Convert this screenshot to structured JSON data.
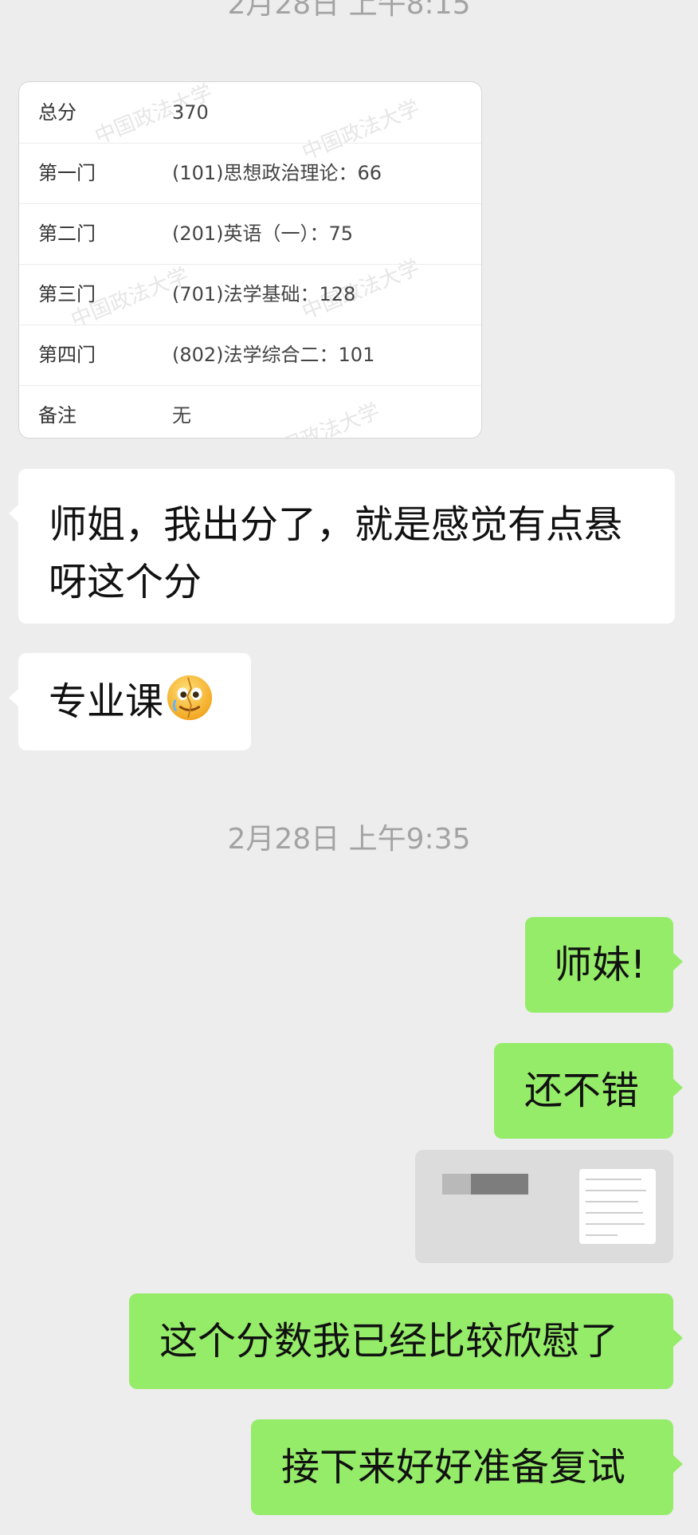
{
  "timestamps": {
    "top": "2月28日 上午8:15",
    "middle": "2月28日 上午9:35"
  },
  "score_card": {
    "watermark": "中国政法大学",
    "rows": [
      {
        "label": "总分",
        "value": "370"
      },
      {
        "label": "第一门",
        "value": "(101)思想政治理论：66"
      },
      {
        "label": "第二门",
        "value": "(201)英语（一）：75"
      },
      {
        "label": "第三门",
        "value": "(701)法学基础：128"
      },
      {
        "label": "第四门",
        "value": "(802)法学综合二：101"
      },
      {
        "label": "备注",
        "value": "无"
      }
    ]
  },
  "messages": {
    "incoming_1": "师姐，我出分了，就是感觉有点悬\n呀这个分",
    "incoming_2": "专业课",
    "incoming_2_emoji": "crying-smile-emoji",
    "outgoing_1": "师妹!",
    "outgoing_2": "还不错",
    "outgoing_3": "这个分数我已经比较欣慰了",
    "outgoing_4": "接下来好好准备复试"
  },
  "colors": {
    "background": "#ededed",
    "incoming_bubble": "#ffffff",
    "outgoing_bubble": "#95ec69",
    "timestamp_text": "#a3a3a3"
  }
}
